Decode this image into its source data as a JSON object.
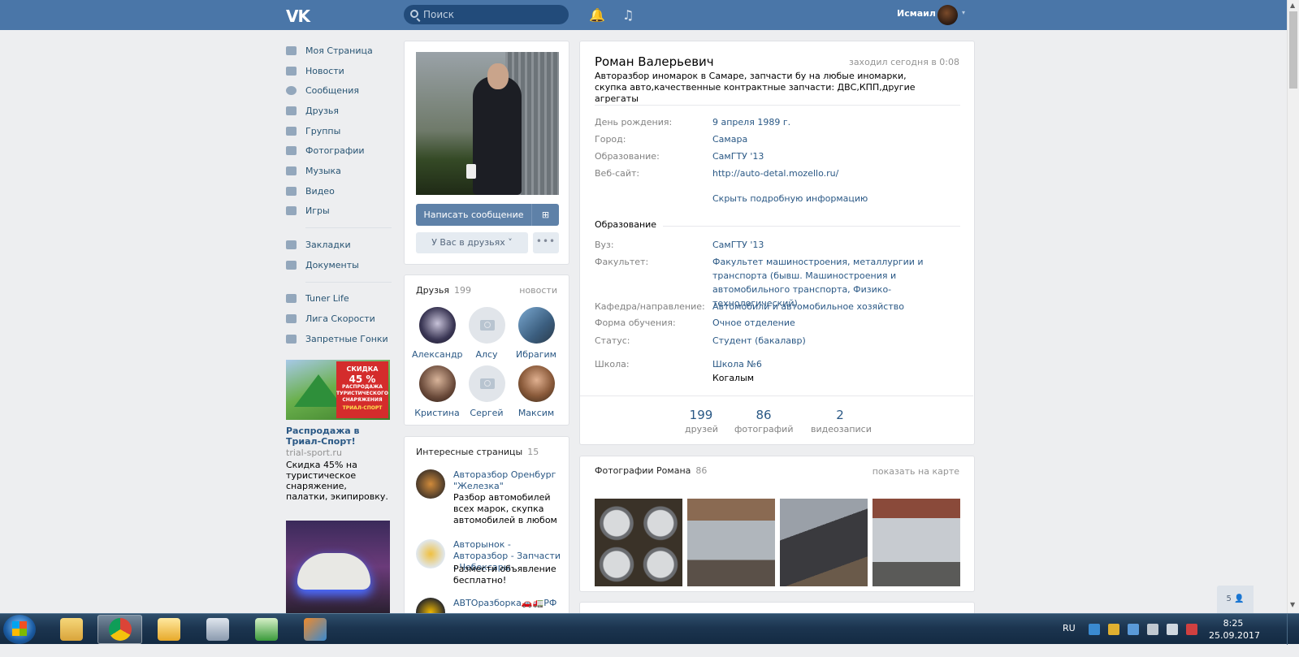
{
  "topbar": {
    "logo": "VK",
    "search_placeholder": "Поиск",
    "user_name": "Исмаил",
    "caret": "▾",
    "bell_glyph": "🔔",
    "music_glyph": "♫"
  },
  "nav": {
    "items": [
      {
        "label": "Моя Страница",
        "icon": "home-icon"
      },
      {
        "label": "Новости",
        "icon": "news-icon"
      },
      {
        "label": "Сообщения",
        "icon": "message-icon"
      },
      {
        "label": "Друзья",
        "icon": "user-icon"
      },
      {
        "label": "Группы",
        "icon": "users-icon"
      },
      {
        "label": "Фотографии",
        "icon": "camera-icon"
      },
      {
        "label": "Музыка",
        "icon": "music-icon"
      },
      {
        "label": "Видео",
        "icon": "video-icon"
      },
      {
        "label": "Игры",
        "icon": "gamepad-icon"
      }
    ],
    "items2": [
      {
        "label": "Закладки",
        "icon": "star-icon"
      },
      {
        "label": "Документы",
        "icon": "document-icon"
      }
    ],
    "apps": [
      {
        "label": "Tuner Life",
        "icon": "car-icon"
      },
      {
        "label": "Лига Скорости",
        "icon": "car-icon"
      },
      {
        "label": "Запретные Гонки",
        "icon": "car-icon"
      }
    ]
  },
  "ad": {
    "badge_line1": "СКИДКА",
    "badge_line2": "45 %",
    "badge_line3": "РАСПРОДАЖА ТУРИСТИЧЕСКОГО СНАРЯЖЕНИЯ",
    "badge_brand": "ТРИАЛ-СПОРТ",
    "title": "Распродажа в Триал-Спорт!",
    "domain": "trial-sport.ru",
    "text": "Скидка 45% на туристическое снаряжение, палатки, экипировку."
  },
  "profile_actions": {
    "write_message": "Написать сообщение",
    "gift_glyph": "⊞",
    "friend_status": "У Вас в друзьях ˅",
    "more": "•••"
  },
  "friends": {
    "title": "Друзья",
    "count": "199",
    "news_link": "новости",
    "items": [
      {
        "name": "Александр"
      },
      {
        "name": "Алсу"
      },
      {
        "name": "Ибрагим"
      },
      {
        "name": "Кристина"
      },
      {
        "name": "Сергей"
      },
      {
        "name": "Максим"
      }
    ]
  },
  "interesting": {
    "title": "Интересные страницы",
    "count": "15",
    "items": [
      {
        "title": "Авторазбор Оренбург \"Железка\"",
        "desc": "Разбор автомобилей всех марок, скупка автомобилей в любом"
      },
      {
        "title": "Авторынок - Авторазбор - Запчасти - Чебоксары",
        "desc": "Размести объявление бесплатно!"
      },
      {
        "title": "АВТОразборка🚗🚛РФ",
        "desc": ""
      }
    ]
  },
  "profile": {
    "name": "Роман Валерьевич",
    "online": "заходил сегодня в 0:08",
    "status": "Авторазбор иномарок в Самаре, запчасти бу на любые иномарки, скупка авто,качественные контрактные запчасти: ДВС,КПП,другие агрегаты",
    "basic": [
      {
        "label": "День рождения:",
        "value": "9 апреля 1989 г."
      },
      {
        "label": "Город:",
        "value": "Самара"
      },
      {
        "label": "Образование:",
        "value": "СамГТУ '13"
      },
      {
        "label": "Веб-сайт:",
        "value": "http://auto-detal.mozello.ru/"
      }
    ],
    "hide_details": "Скрыть подробную информацию",
    "education_title": "Образование",
    "education": [
      {
        "label": "Вуз:",
        "value": "СамГТУ '13"
      },
      {
        "label": "Факультет:",
        "value": "Факультет машиностроения, металлургии и транспорта (бывш. Машиностроения и автомобильного транспорта, Физико-технологический)"
      },
      {
        "label": "Кафедра/направление:",
        "value": "Автомобили и автомобильное хозяйство"
      },
      {
        "label": "Форма обучения:",
        "value": "Очное отделение"
      },
      {
        "label": "Статус:",
        "value": "Студент (бакалавр)"
      }
    ],
    "school_label": "Школа:",
    "school_name": "Школа №6",
    "school_city": "Когалым",
    "counters": [
      {
        "num": "199",
        "label": "друзей"
      },
      {
        "num": "86",
        "label": "фотографий"
      },
      {
        "num": "2",
        "label": "видеозаписи"
      }
    ]
  },
  "photos": {
    "title": "Фотографии Романа",
    "count": "86",
    "map_link": "показать на карте"
  },
  "side_badge": "5 👤",
  "taskbar": {
    "lang": "RU",
    "time": "8:25",
    "date": "25.09.2017"
  }
}
